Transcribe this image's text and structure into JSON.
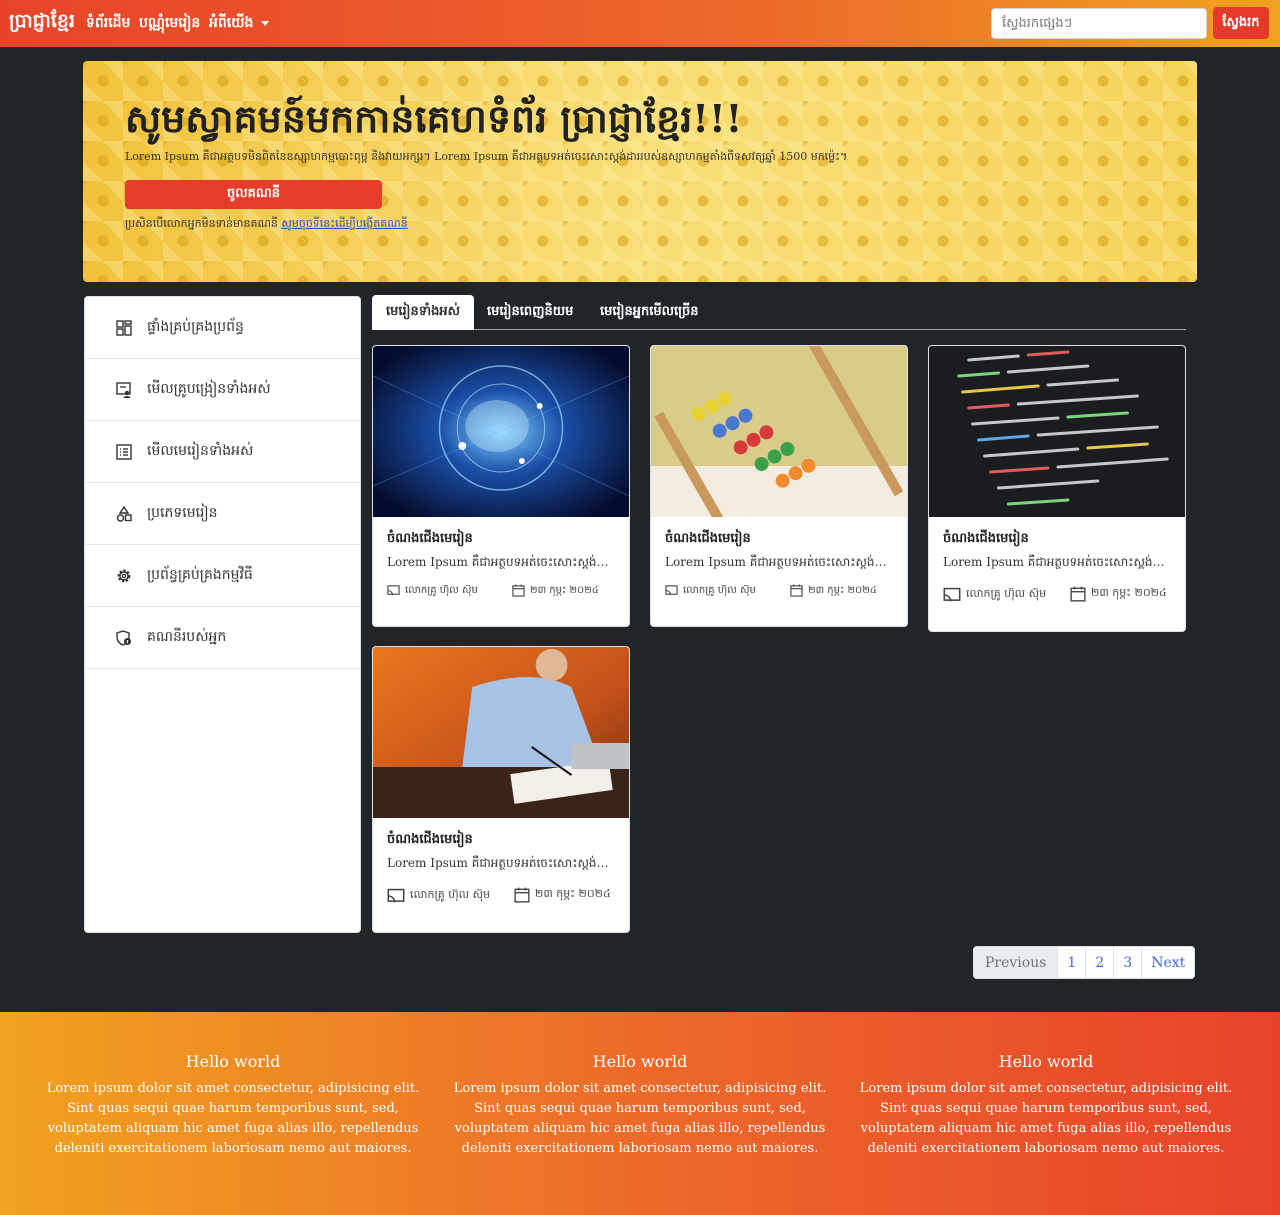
{
  "navbar": {
    "brand": "ប្រាជ្ញាខ្មែរ",
    "links": [
      "ទំព័រដើម",
      "បណ្ណុំមេរៀន",
      "អំពីយើង"
    ],
    "search_placeholder": "ស្វែងរកផ្សេងៗ",
    "search_button": "ស្វែងរក"
  },
  "hero": {
    "title": "សូមស្វាគមន៍មកកាន់គេហទំព័រ ប្រាជ្ញាខ្មែរ!!!",
    "description": "Lorem Ipsum គឺជាអត្ថបទមិនពិតនៃឧស្សាហកម្មបោះពុម្ព និងវាយអក្សរ។ Lorem Ipsum គឺជាអត្ថបទអត់ចេះសោះស្តង់ដាររបស់ឧស្សាហកម្មតាំងពីទសវត្សឆ្នាំ 1500 មកម្ល៉េះ។",
    "button": "ចូលគណនី",
    "note_text": "ប្រសិនបើលោកអ្នកមិនទាន់មានគណនី",
    "note_link": "សូមចុចទីនេះដើម្បីបង្កើតគណនី"
  },
  "sidebar": {
    "items": [
      {
        "label": "ផ្ទាំងគ្រប់គ្រងប្រព័ន្ធ",
        "icon": "dashboard-icon"
      },
      {
        "label": "មើលគ្រូបង្រៀនទាំងអស់",
        "icon": "teacher-icon"
      },
      {
        "label": "មើលមេរៀនទាំងអស់",
        "icon": "list-icon"
      },
      {
        "label": "ប្រភេទមេរៀន",
        "icon": "category-icon"
      },
      {
        "label": "ប្រព័ន្ធគ្រប់គ្រងកម្មវិធី",
        "icon": "gear-icon"
      },
      {
        "label": "គណនីរបស់អ្នក",
        "icon": "account-icon"
      }
    ]
  },
  "tabs": [
    "មេរៀនទាំងអស់",
    "មេរៀនពេញនិយម",
    "មេរៀនអ្នកមើលច្រើន"
  ],
  "cards": [
    {
      "image": "ai-brain-image",
      "title": "ចំណងជើងមេរៀន",
      "text": "Lorem Ipsum គឺជាអត្ថបទអត់ចេះសោះស្តង់ដាររបស់ឧស្សាហកម្ម",
      "teacher": "លោកគ្រូ ហ៊ុល ស៊ុម",
      "date": "២៣ កុម្ភះ ២០២៤"
    },
    {
      "image": "abacus-image",
      "title": "ចំណងជើងមេរៀន",
      "text": "Lorem Ipsum គឺជាអត្ថបទអត់ចេះសោះស្តង់ដាររបស់ឧស្សាហកម្ម",
      "teacher": "លោកគ្រូ ហ៊ុល ស៊ុម",
      "date": "២៣ កុម្ភះ ២០២៤"
    },
    {
      "image": "code-screen-image",
      "title": "ចំណងជើងមេរៀន",
      "text": "Lorem Ipsum គឺជាអត្ថបទអត់ចេះសោះស្តង់ដាររបស់ឧស្សាហកម្ម",
      "teacher": "លោកគ្រូ ហ៊ុល ស៊ុម",
      "date": "២៣ កុម្ភះ ២០២៤"
    },
    {
      "image": "writing-man-image",
      "title": "ចំណងជើងមេរៀន",
      "text": "Lorem Ipsum គឺជាអត្ថបទអត់ចេះសោះស្តង់ដាររបស់ឧស្សាហកម្ម",
      "teacher": "លោកគ្រូ ហ៊ុល ស៊ុម",
      "date": "២៣ កុម្ភះ ២០២៤"
    }
  ],
  "pagination": [
    "Previous",
    "1",
    "2",
    "3",
    "Next"
  ],
  "footer": {
    "columns": [
      {
        "title": "Hello world",
        "text": "Lorem ipsum dolor sit amet consectetur, adipisicing elit. Sint quas sequi quae harum temporibus sunt, sed, voluptatem aliquam hic amet fuga alias illo, repellendus deleniti exercitationem laboriosam nemo aut maiores."
      },
      {
        "title": "Hello world",
        "text": "Lorem ipsum dolor sit amet consectetur, adipisicing elit. Sint quas sequi quae harum temporibus sunt, sed, voluptatem aliquam hic amet fuga alias illo, repellendus deleniti exercitationem laboriosam nemo aut maiores."
      },
      {
        "title": "Hello world",
        "text": "Lorem ipsum dolor sit amet consectetur, adipisicing elit. Sint quas sequi quae harum temporibus sunt, sed, voluptatem aliquam hic amet fuga alias illo, repellendus deleniti exercitationem laboriosam nemo aut maiores."
      }
    ]
  },
  "colors": {
    "accent_red": "#e63c2a",
    "accent_orange": "#f0a21f",
    "page_bg": "#212529"
  }
}
